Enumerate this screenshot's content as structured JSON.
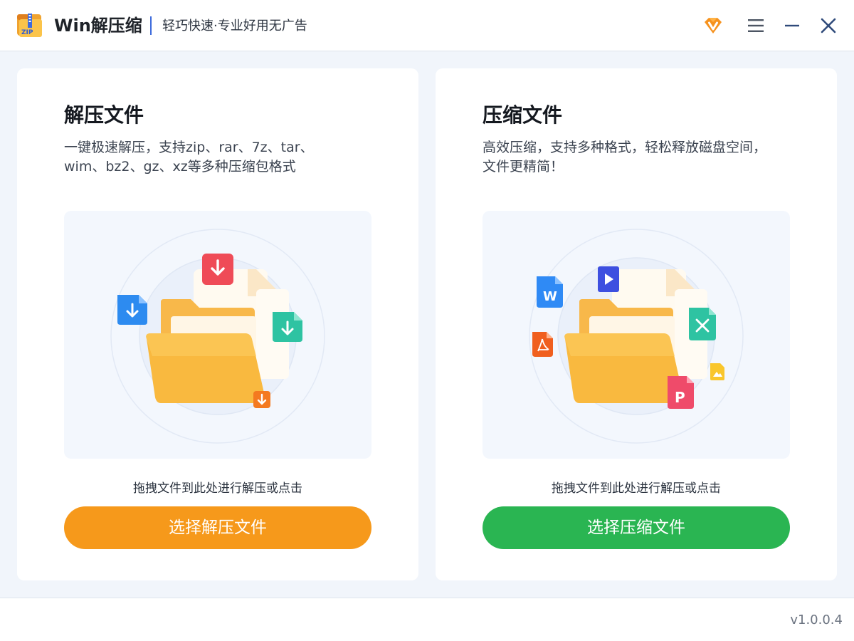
{
  "titlebar": {
    "app_name": "Win解压缩",
    "slogan": "轻巧快速·专业好用无广告",
    "logo_icon": "zip-archive-icon",
    "logo_text": "ZIP",
    "buttons": [
      {
        "icon": "vip-diamond-icon"
      },
      {
        "icon": "menu-icon"
      },
      {
        "icon": "minimize-icon"
      },
      {
        "icon": "close-icon"
      }
    ]
  },
  "extract": {
    "title": "解压文件",
    "description": "一键极速解压，支持zip、rar、7z、tar、wim、bz2、gz、xz等多种压缩包格式",
    "hint": "拖拽文件到此处进行解压或点击",
    "button_label": "选择解压文件",
    "accent_color": "#f6991b",
    "illustration_icon": "folder-extract-icon"
  },
  "compress": {
    "title": "压缩文件",
    "description": "高效压缩，支持多种格式，轻松释放磁盘空间，文件更精简！",
    "hint": "拖拽文件到此处进行解压或点击",
    "button_label": "选择压缩文件",
    "accent_color": "#2ab552",
    "illustration_icon": "folder-compress-icon",
    "file_badges": {
      "word": "W",
      "ppt": "P"
    }
  },
  "footer": {
    "version": "v1.0.0.4"
  }
}
